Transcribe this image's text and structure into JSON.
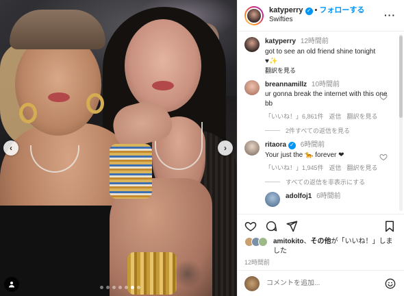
{
  "post": {
    "carousel": {
      "total_dots": 7,
      "active_dot": 5
    },
    "nav": {
      "prev": "‹",
      "next": "›"
    }
  },
  "header": {
    "username": "katyperry",
    "verified": "✓",
    "separator": "•",
    "follow_label": "フォローする",
    "subtitle": "Swifties",
    "more_label": "···"
  },
  "comments": [
    {
      "username": "katyperry",
      "time": "12時間前",
      "text_line1": "got to see an old friend shine tonight",
      "text_line2": "♥✨",
      "translate": "翻訳を見る",
      "avatar_color": "#5a3f3a"
    },
    {
      "username": "breannamillz",
      "time": "10時間前",
      "text": "ur gonna break the internet with this one bb",
      "likes": "「いいね！」6,861件",
      "reply": "返信",
      "translate": "翻訳を見る",
      "avatar_color": "#d9a38e"
    },
    {
      "username": "ritaora",
      "verified": "✓",
      "time": "6時間前",
      "text": "Your just the 🐆 forever ❤",
      "likes": "「いいね！」1,945件",
      "reply": "返信",
      "translate": "翻訳を見る",
      "avatar_color": "#c9bfae"
    },
    {
      "username": "adolfoj1",
      "time": "6時間前",
      "avatar_color": "#7f9cc0"
    }
  ],
  "replies": [
    {
      "label": "2件すべての返信を見る"
    },
    {
      "label": "すべての返信を非表示にする"
    }
  ],
  "likes_summary": {
    "user": "amitokito",
    "connector": "、",
    "others": "その他",
    "suffix": "が「いいね！」しました"
  },
  "timestamp": "12時間前",
  "add_comment": {
    "placeholder": "コメントを追加..."
  }
}
